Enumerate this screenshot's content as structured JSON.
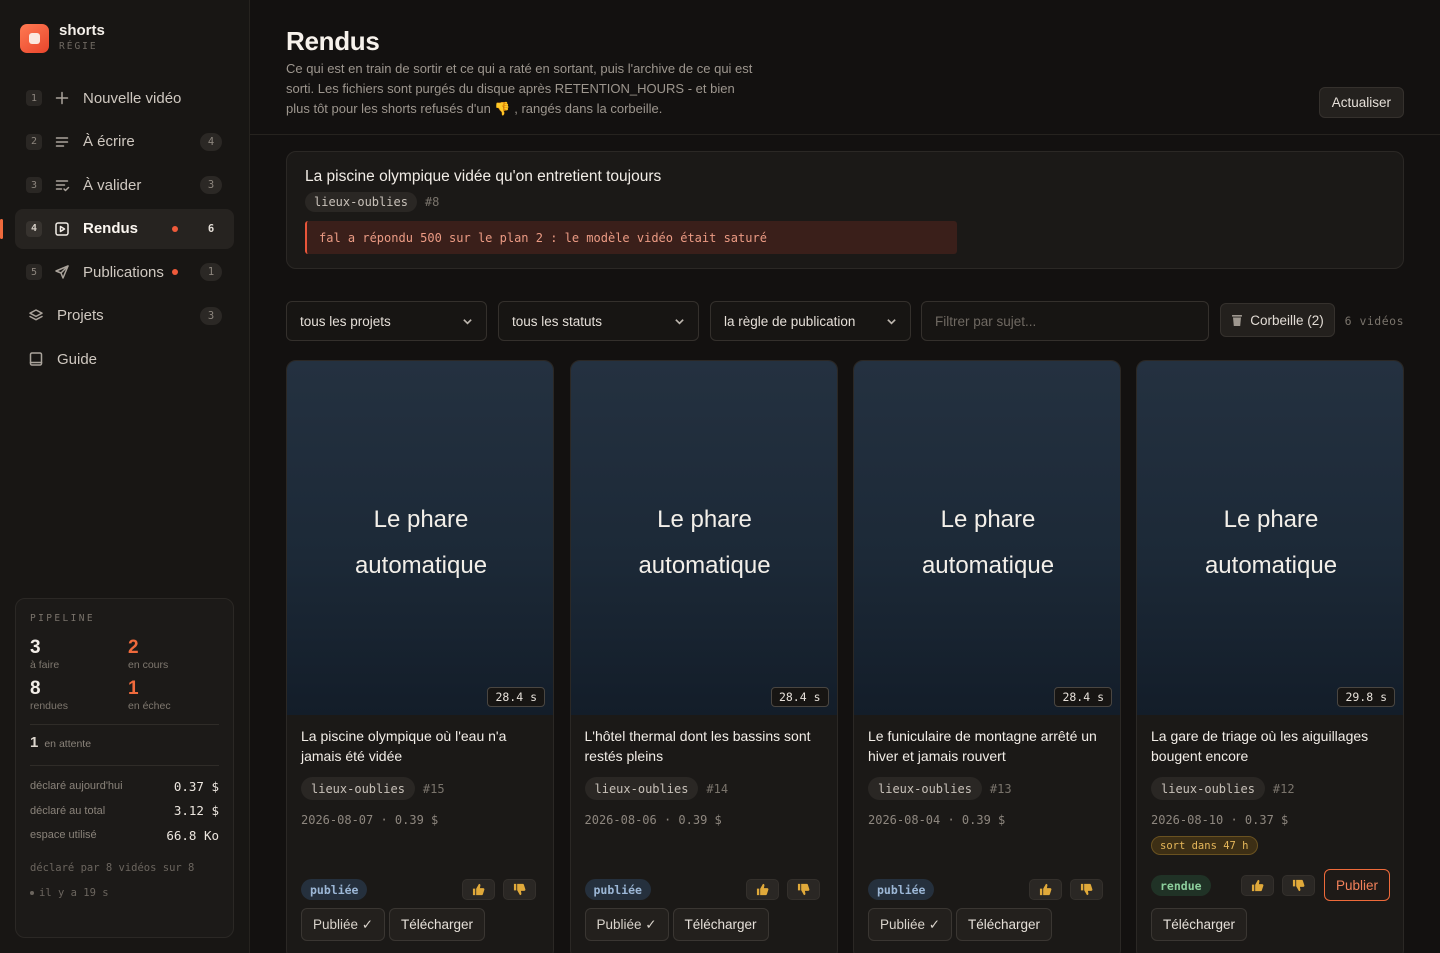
{
  "brand": {
    "name": "shorts",
    "sub": "RÉGIE"
  },
  "nav": [
    {
      "num": "1",
      "label": "Nouvelle vidéo",
      "icon": "plus-icon",
      "count": "",
      "dot": false,
      "active": false
    },
    {
      "num": "2",
      "label": "À écrire",
      "icon": "lines-icon",
      "count": "4",
      "dot": false,
      "active": false
    },
    {
      "num": "3",
      "label": "À valider",
      "icon": "checklist-icon",
      "count": "3",
      "dot": false,
      "active": false
    },
    {
      "num": "4",
      "label": "Rendus",
      "icon": "play-square-icon",
      "count": "6",
      "dot": true,
      "active": true
    },
    {
      "num": "5",
      "label": "Publications",
      "icon": "send-icon",
      "count": "1",
      "dot": true,
      "active": false
    },
    {
      "num": "",
      "label": "Projets",
      "icon": "layers-icon",
      "count": "3",
      "dot": false,
      "active": false
    },
    {
      "num": "",
      "label": "Guide",
      "icon": "book-icon",
      "count": "",
      "dot": false,
      "active": false
    }
  ],
  "pipeline": {
    "title": "PIPELINE",
    "todo": {
      "value": "3",
      "label": "à faire"
    },
    "running": {
      "value": "2",
      "label": "en cours"
    },
    "rendered": {
      "value": "8",
      "label": "rendues"
    },
    "failed": {
      "value": "1",
      "label": "en échec"
    },
    "waiting": {
      "value": "1",
      "label": "en attente"
    },
    "costs": [
      {
        "label": "déclaré aujourd'hui",
        "value": "0.37 $"
      },
      {
        "label": "déclaré au total",
        "value": "3.12 $"
      },
      {
        "label": "espace utilisé",
        "value": "66.8 Ko"
      }
    ],
    "footer": "déclaré par 8 vidéos sur 8",
    "ago": "il y a 19 s"
  },
  "header": {
    "title": "Rendus",
    "description": "Ce qui est en train de sortir et ce qui a raté en sortant, puis l'archive de ce qui est sorti. Les fichiers sont purgés du disque après RETENTION_HOURS - et bien plus tôt pour les shorts refusés d'un 👎 , rangés dans la corbeille.",
    "refresh_label": "Actualiser"
  },
  "error_card": {
    "title": "La piscine olympique vidée qu'on entretient toujours",
    "tag": "lieux-oublies",
    "id": "#8",
    "message": "fal a répondu 500 sur le plan 2 : le modèle vidéo était saturé"
  },
  "filters": {
    "project": "tous les projets",
    "status": "tous les statuts",
    "rule": "la règle de publication",
    "search_placeholder": "Filtrer par sujet...",
    "trash_label": "Corbeille (2)",
    "count": "6 vidéos"
  },
  "cards": [
    {
      "thumb_line1": "Le phare",
      "thumb_line2": "automatique",
      "duration": "28.4 s",
      "title": "La piscine olympique où l'eau n'a jamais été vidée",
      "tag": "lieux-oublies",
      "id": "#15",
      "meta": "2026-08-07 · 0.39 $",
      "expire": "",
      "status": "publiée",
      "status_kind": "pub",
      "primary": "Publiée ✓",
      "secondary": "Télécharger"
    },
    {
      "thumb_line1": "Le phare",
      "thumb_line2": "automatique",
      "duration": "28.4 s",
      "title": "L'hôtel thermal dont les bassins sont restés pleins",
      "tag": "lieux-oublies",
      "id": "#14",
      "meta": "2026-08-06 · 0.39 $",
      "expire": "",
      "status": "publiée",
      "status_kind": "pub",
      "primary": "Publiée ✓",
      "secondary": "Télécharger"
    },
    {
      "thumb_line1": "Le phare",
      "thumb_line2": "automatique",
      "duration": "28.4 s",
      "title": "Le funiculaire de montagne arrêté un hiver et jamais rouvert",
      "tag": "lieux-oublies",
      "id": "#13",
      "meta": "2026-08-04 · 0.39 $",
      "expire": "",
      "status": "publiée",
      "status_kind": "pub",
      "primary": "Publiée ✓",
      "secondary": "Télécharger"
    },
    {
      "thumb_line1": "Le phare",
      "thumb_line2": "automatique",
      "duration": "29.8 s",
      "title": "La gare de triage où les aiguillages bougent encore",
      "tag": "lieux-oublies",
      "id": "#12",
      "meta": "2026-08-10 · 0.37 $",
      "expire": "sort dans 47 h",
      "status": "rendue",
      "status_kind": "ren",
      "primary": "Publier",
      "secondary": "Télécharger"
    }
  ]
}
